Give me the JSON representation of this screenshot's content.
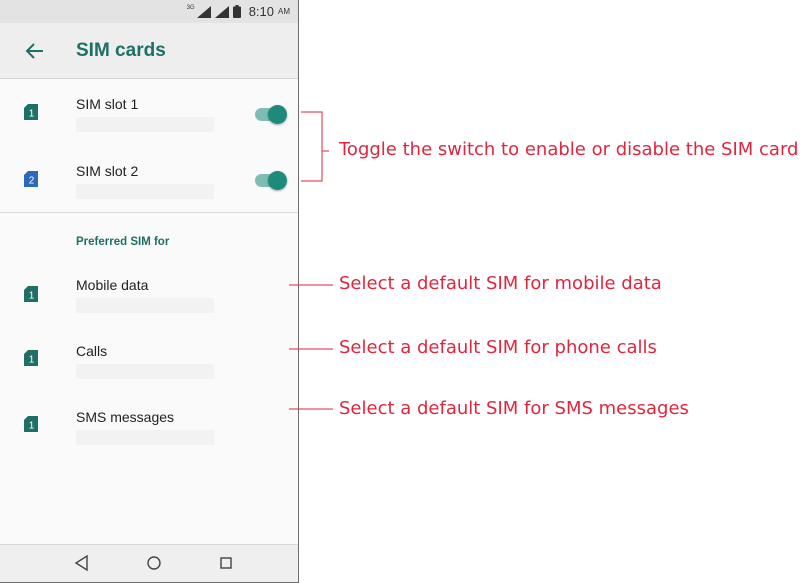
{
  "status_bar": {
    "network_label": "3G",
    "time": "8:10",
    "ampm": "AM"
  },
  "app_bar": {
    "back_icon": "arrow-left-icon",
    "title": "SIM cards"
  },
  "sim_slots": [
    {
      "badge": "1",
      "label": "SIM slot 1",
      "enabled": true,
      "badge_color": "#1e6f65"
    },
    {
      "badge": "2",
      "label": "SIM slot 2",
      "enabled": true,
      "badge_color": "#2c6ab8"
    }
  ],
  "preferred": {
    "header": "Preferred SIM for",
    "items": [
      {
        "badge": "1",
        "label": "Mobile data"
      },
      {
        "badge": "1",
        "label": "Calls"
      },
      {
        "badge": "1",
        "label": "SMS messages"
      }
    ]
  },
  "nav_bar": {
    "buttons": [
      "back-triangle-icon",
      "home-circle-icon",
      "recents-square-icon"
    ]
  },
  "callouts": {
    "toggle": "Toggle the switch to enable or disable the SIM card",
    "mobile_data": "Select a default SIM for mobile data",
    "calls": "Select a default SIM for phone calls",
    "sms": "Select a default SIM for SMS messages"
  },
  "colors": {
    "accent": "#1e6f65",
    "toggle_thumb": "#1d8a7c",
    "annotation": "#e0263d"
  }
}
